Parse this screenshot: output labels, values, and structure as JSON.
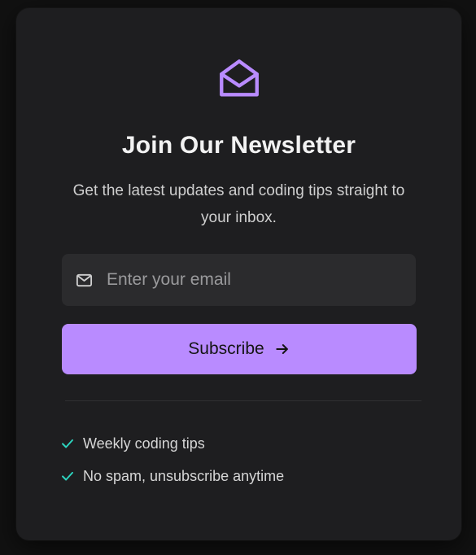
{
  "card": {
    "icon": "envelope-open-icon",
    "title": "Join Our Newsletter",
    "subtitle": "Get the latest updates and coding tips straight to your inbox."
  },
  "form": {
    "email_icon": "mail-icon",
    "email_placeholder": "Enter your email",
    "email_value": "",
    "subscribe_label": "Subscribe",
    "subscribe_icon": "arrow-right-icon"
  },
  "features": [
    {
      "icon": "check-icon",
      "label": "Weekly coding tips"
    },
    {
      "icon": "check-icon",
      "label": "No spam, unsubscribe anytime"
    }
  ],
  "colors": {
    "accent": "#b98bff",
    "check": "#2dd4bf",
    "card_bg": "#1e1e20",
    "page_bg": "#111111"
  }
}
